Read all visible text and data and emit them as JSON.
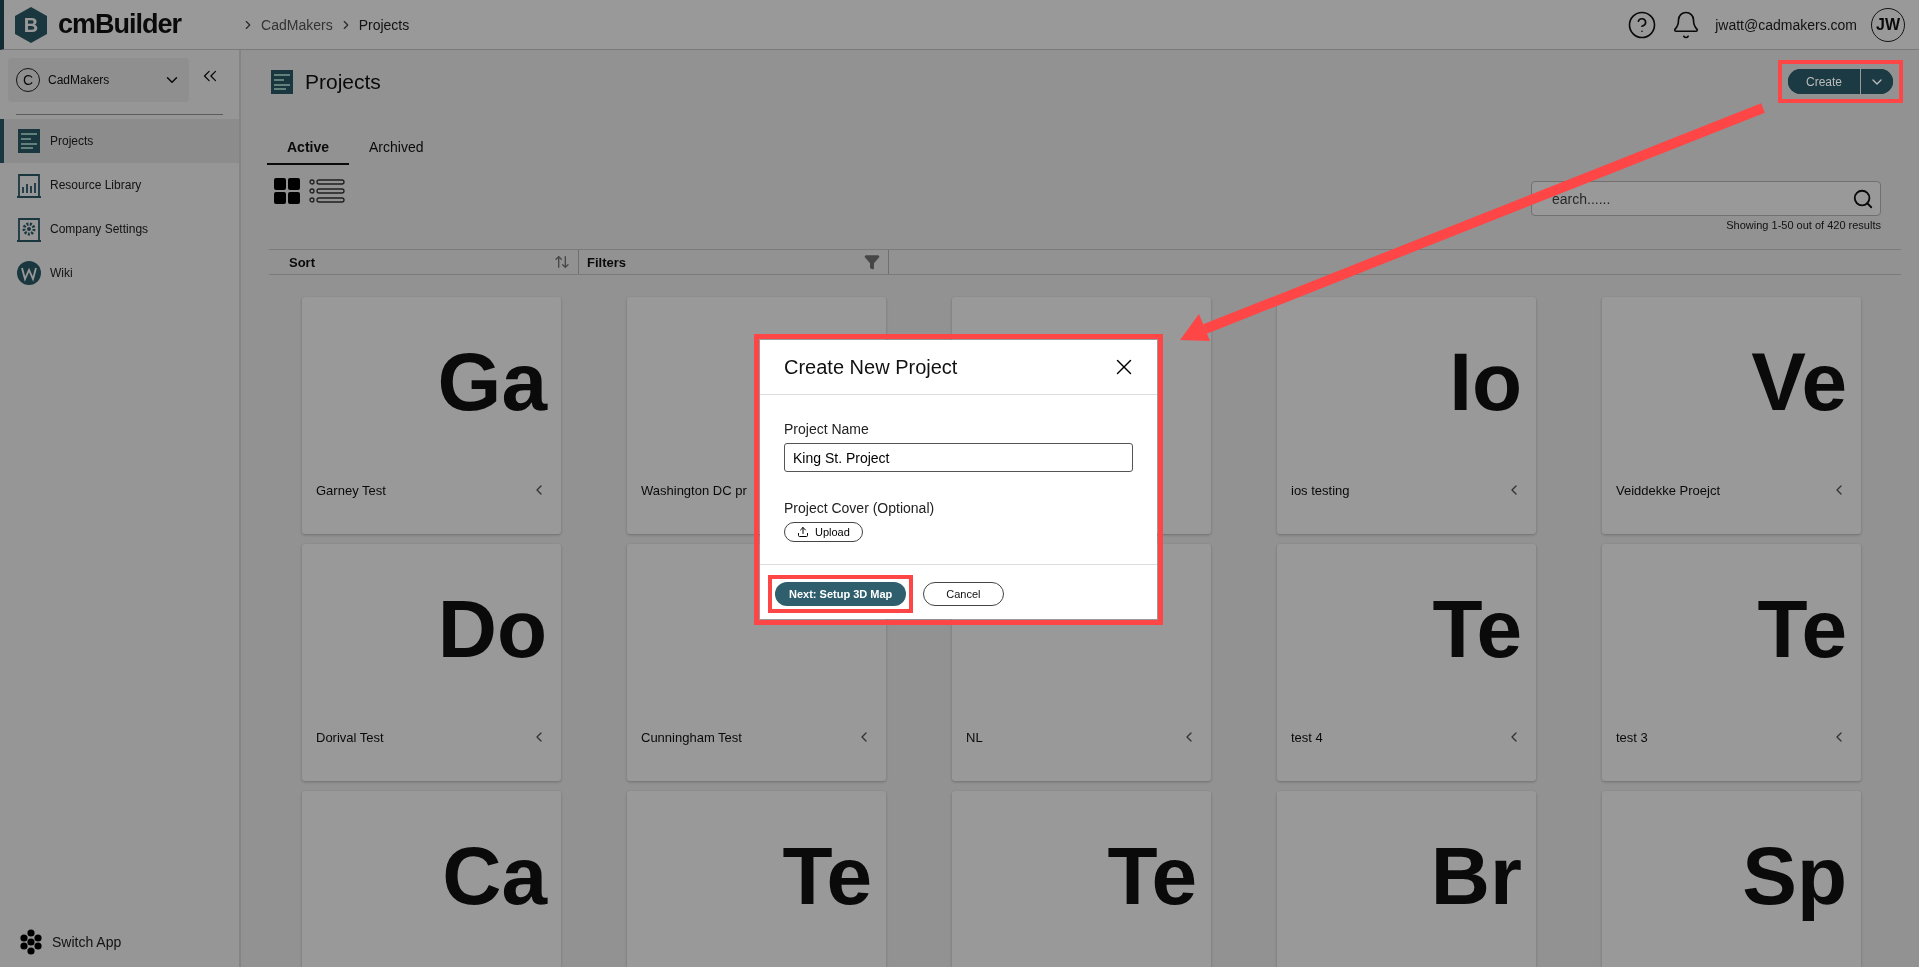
{
  "header": {
    "logo_letter": "B",
    "brand": "cmBuilder",
    "breadcrumbs": [
      "CadMakers",
      "Projects"
    ],
    "user_email": "jwatt@cadmakers.com",
    "avatar_initials": "JW"
  },
  "sidebar": {
    "company": {
      "initial": "C",
      "name": "CadMakers"
    },
    "items": [
      {
        "label": "Projects",
        "selected": true
      },
      {
        "label": "Resource Library",
        "selected": false
      },
      {
        "label": "Company Settings",
        "selected": false
      },
      {
        "label": "Wiki",
        "selected": false
      }
    ],
    "switch_app": "Switch App"
  },
  "page": {
    "title": "Projects",
    "create_button": "Create",
    "tabs": [
      {
        "label": "Active",
        "selected": true
      },
      {
        "label": "Archived",
        "selected": false
      }
    ],
    "search": {
      "placeholder": "earch......"
    },
    "results": "Showing 1-50 out of 420 results",
    "sort_label": "Sort",
    "filters_label": "Filters",
    "projects": [
      {
        "kind": "card",
        "initials": "Ga",
        "name": "Garney Test"
      },
      {
        "kind": "card",
        "name": "Washington DC pr"
      },
      {
        "kind": "card"
      },
      {
        "kind": "card",
        "initials": "Io",
        "name": "ios testing"
      },
      {
        "kind": "card",
        "initials": "Ve",
        "name": "Veiddekke Proejct"
      },
      {
        "kind": "card",
        "initials": "Do",
        "name": "Dorival Test"
      },
      {
        "kind": "card",
        "name": "Cunningham Test"
      },
      {
        "kind": "card",
        "name": "NL"
      },
      {
        "kind": "card",
        "initials": "Te",
        "name": "test 4"
      },
      {
        "kind": "card",
        "initials": "Te",
        "name": "test 3"
      },
      {
        "kind": "card",
        "initials": "Ca"
      },
      {
        "kind": "card",
        "initials": "Te"
      },
      {
        "kind": "card",
        "initials": "Te"
      },
      {
        "kind": "card",
        "initials": "Br"
      },
      {
        "kind": "card",
        "initials": "Sp"
      }
    ]
  },
  "dialog": {
    "title": "Create New Project",
    "name_label": "Project Name",
    "name_value": "King St. Project",
    "cover_label": "Project Cover (Optional)",
    "upload_button": "Upload",
    "primary_button": "Next: Setup 3D Map",
    "cancel_button": "Cancel"
  }
}
